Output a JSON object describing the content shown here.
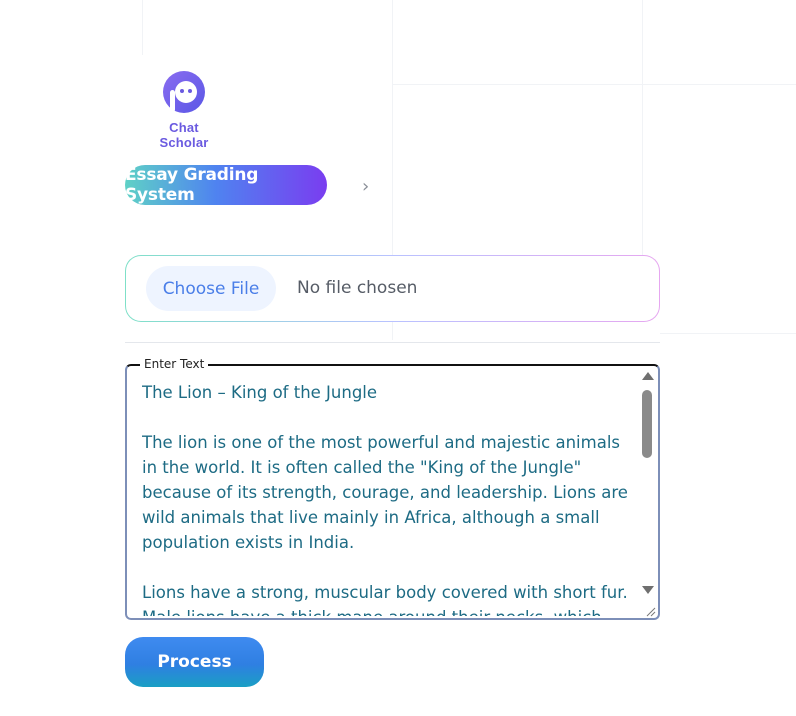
{
  "brand": {
    "name": "Chat Scholar",
    "logo_icon": "chat-bubble-icon",
    "accent": "#6a5ae0"
  },
  "header": {
    "title": "Essay Grading System",
    "chevron_icon": "chevron-right-icon"
  },
  "file_upload": {
    "button_label": "Choose File",
    "status": "No file chosen"
  },
  "text_input": {
    "legend": "Enter Text",
    "value": "The Lion – King of the Jungle\n\nThe lion is one of the most powerful and majestic animals in the world. It is often called the \"King of the Jungle\" because of its strength, courage, and leadership. Lions are wild animals that live mainly in Africa, although a small population exists in India.\n\nLions have a strong, muscular body covered with short fur. Male lions have a thick mane around their necks, which makes"
  },
  "actions": {
    "process_label": "Process"
  },
  "colors": {
    "text": "#1d6b84",
    "title_gradient_start": "#5fd1c6",
    "title_gradient_end": "#7a3df0",
    "process_button": "#3f8bf0"
  }
}
